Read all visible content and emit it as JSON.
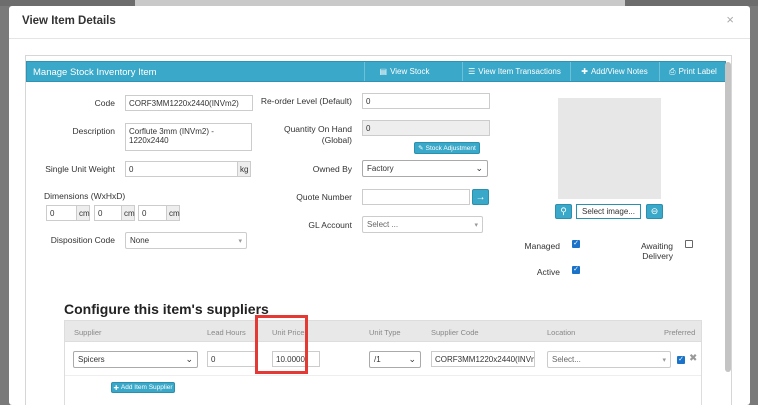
{
  "modal": {
    "title": "View Item Details",
    "close": "×"
  },
  "panel": {
    "title": "Manage Stock Inventory Item",
    "buttons": [
      {
        "icon": "▤",
        "label": "View Stock"
      },
      {
        "icon": "☰",
        "label": "View Item Transactions"
      },
      {
        "icon": "✚",
        "label": "Add/View Notes"
      },
      {
        "icon": "⎙",
        "label": "Print Label"
      }
    ]
  },
  "fields": {
    "code": {
      "label": "Code",
      "value": "CORF3MM1220x2440(INVm2)"
    },
    "description": {
      "label": "Description",
      "value": "Corflute 3mm (INVm2) - 1220x2440"
    },
    "single_unit_weight": {
      "label": "Single Unit Weight",
      "value": "0",
      "unit": "kg"
    },
    "dimensions": {
      "label": "Dimensions (WxHxD)",
      "w": "0",
      "h": "0",
      "d": "0",
      "unit": "cm"
    },
    "disposition_code": {
      "label": "Disposition Code",
      "value": "None"
    },
    "reorder_level": {
      "label": "Re-order Level (Default)",
      "value": "0"
    },
    "quantity_on_hand": {
      "label": "Quantity On Hand",
      "label2": "(Global)",
      "value": "0"
    },
    "stock_adjustment": {
      "icon": "✎",
      "label": "Stock Adjustment"
    },
    "owned_by": {
      "label": "Owned By",
      "value": "Factory"
    },
    "quote_number": {
      "label": "Quote Number",
      "value": "",
      "go": "→"
    },
    "gl_account": {
      "label": "GL Account",
      "value": "Select ..."
    }
  },
  "image": {
    "select_label": "Select image...",
    "search_icon": "⚲",
    "clear_icon": "⊖"
  },
  "flags": {
    "managed": {
      "label": "Managed",
      "checked": true
    },
    "awaiting_delivery": {
      "label": "Awaiting Delivery",
      "checked": false
    },
    "active": {
      "label": "Active",
      "checked": true
    }
  },
  "suppliers": {
    "title": "Configure this item's suppliers",
    "columns": [
      "Supplier",
      "Lead Hours",
      "Unit Price",
      "Unit Type",
      "Supplier Code",
      "Location",
      "Preferred"
    ],
    "rows": [
      {
        "supplier": "Spicers",
        "lead_hours": "0",
        "unit_price": "10.0000",
        "unit_type": "/1",
        "supplier_code": "CORF3MM1220x2440(INVm",
        "location": "Select...",
        "preferred": true
      }
    ],
    "add_button": {
      "icon": "✚",
      "label": "Add Item Supplier"
    }
  },
  "colors": {
    "accent": "#3aa8c8",
    "highlight": "#e53935",
    "checkbox": "#1a73c9"
  }
}
